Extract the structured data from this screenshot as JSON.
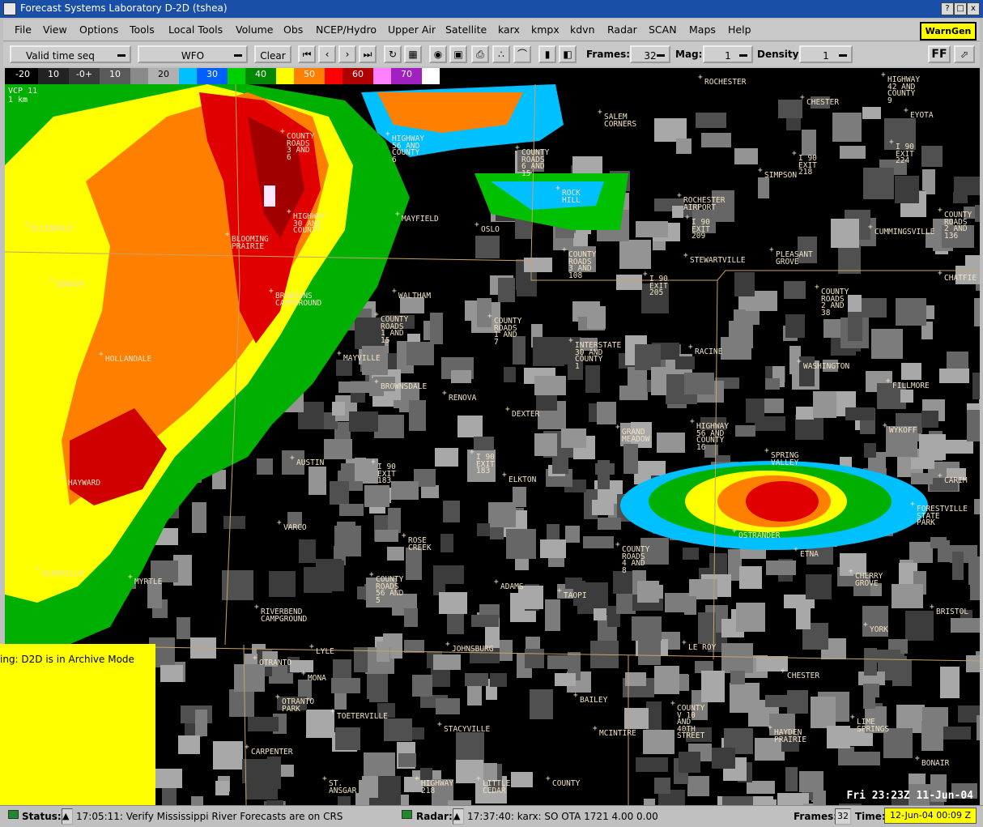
{
  "window": {
    "title": "Forecast Systems Laboratory D-2D (tshea)",
    "buttons": [
      "?",
      "□",
      "x"
    ]
  },
  "menu": [
    "File",
    "View",
    "Options",
    "Tools",
    "Local Tools",
    "Volume",
    "Obs",
    "NCEP/Hydro",
    "Upper Air",
    "Satellite",
    "karx",
    "kmpx",
    "kdvn",
    "Radar",
    "SCAN",
    "Maps",
    "Help"
  ],
  "warngen": "WarnGen",
  "toolbar": {
    "time_mode": "Valid time seq",
    "scale": "WFO",
    "clear": "Clear",
    "frames_label": "Frames:",
    "frames_value": "32",
    "mag_label": "Mag:",
    "mag_value": "1",
    "density_label": "Density:",
    "density_value": "1",
    "ff_label": "FF"
  },
  "colorbar": [
    {
      "label": "-20",
      "color": "#000000"
    },
    {
      "label": "10",
      "color": "#222222"
    },
    {
      "label": "-0+",
      "color": "#3a3a3a"
    },
    {
      "label": "10",
      "color": "#5a5a5a"
    },
    {
      "label": "",
      "color": "#8a8a8a"
    },
    {
      "label": "20",
      "color": "#b0b0b0"
    },
    {
      "label": "",
      "color": "#00c0ff"
    },
    {
      "label": "30",
      "color": "#0060ff"
    },
    {
      "label": "",
      "color": "#00d000"
    },
    {
      "label": "40",
      "color": "#008800"
    },
    {
      "label": "",
      "color": "#ffff00"
    },
    {
      "label": "50",
      "color": "#ff8000"
    },
    {
      "label": "",
      "color": "#ff0000"
    },
    {
      "label": "60",
      "color": "#b00000"
    },
    {
      "label": "",
      "color": "#ff80ff"
    },
    {
      "label": "70",
      "color": "#a020c0"
    },
    {
      "label": "",
      "color": "#ffffff"
    }
  ],
  "product": {
    "line1": "VCP 11",
    "line2": "1 km"
  },
  "places": [
    {
      "name": "ROCHESTER"
    },
    {
      "name": "CHESTER"
    },
    {
      "name": "HIGHWAY\n42 AND\nCOUNTY\n9"
    },
    {
      "name": "EYOTA"
    },
    {
      "name": "SALEM\nCORNERS"
    },
    {
      "name": "COUNTY\nROADS\n3 AND\n6"
    },
    {
      "name": "HIGHWAY\n56 AND\nCOUNTY\n6"
    },
    {
      "name": "COUNTY\nROADS\n6 AND\n15"
    },
    {
      "name": "I 90\nEXIT\n218"
    },
    {
      "name": "I 90\nEXIT\n224"
    },
    {
      "name": "SIMPSON"
    },
    {
      "name": "HIGHWAY\n30 AND\nCOUNTY"
    },
    {
      "name": "ROCK\nHILL"
    },
    {
      "name": "ROCHESTER\nAIRPORT"
    },
    {
      "name": "MAYFIELD"
    },
    {
      "name": "ELLENDALE"
    },
    {
      "name": "BLOOMING\nPRAIRIE"
    },
    {
      "name": "OSLO"
    },
    {
      "name": "I 90\nEXIT\n209"
    },
    {
      "name": "COUNTY\nROADS\n2 AND\n136"
    },
    {
      "name": "CUMMINGSVILLE"
    },
    {
      "name": "STEWARTVILLE"
    },
    {
      "name": "PLEASANT\nGROVE"
    },
    {
      "name": "COUNTY\nROADS\n3 AND\n108"
    },
    {
      "name": "GENEVA"
    },
    {
      "name": "BRONSONS\nCAMPGROUND"
    },
    {
      "name": "WALTHAM"
    },
    {
      "name": "I 90\nEXIT\n205"
    },
    {
      "name": "COUNTY\nROADS\n2 AND\n38"
    },
    {
      "name": "CHATFIE"
    },
    {
      "name": "COUNTY\nROADS\n1 AND\n15"
    },
    {
      "name": "COUNTY\nROADS\n1 AND\n7"
    },
    {
      "name": "RACINE"
    },
    {
      "name": "INTERSTATE\n30 AND\nCOUNTY\n1"
    },
    {
      "name": "HOLLANDALE"
    },
    {
      "name": "MAYVILLE"
    },
    {
      "name": "WASHINGTON"
    },
    {
      "name": "BROWNSDALE"
    },
    {
      "name": "RENOVA"
    },
    {
      "name": "FILLMORE"
    },
    {
      "name": "DEXTER"
    },
    {
      "name": "GRAND\nMEADOW"
    },
    {
      "name": "HIGHWAY\n56 AND\nCOUNTY\n16"
    },
    {
      "name": "WYKOFF"
    },
    {
      "name": "AUSTIN"
    },
    {
      "name": "I 90\nEXIT\n183"
    },
    {
      "name": "I 90\nEXIT\n183"
    },
    {
      "name": "ELKTON"
    },
    {
      "name": "SPRING\nVALLEY"
    },
    {
      "name": "HAYWARD"
    },
    {
      "name": "CARIM"
    },
    {
      "name": "FORESTVILLE\nSTATE\nPARK"
    },
    {
      "name": "VARCO"
    },
    {
      "name": "OSTRANDER"
    },
    {
      "name": "ROSE\nCREEK"
    },
    {
      "name": "COUNTY\nROADS\n4 AND\n8"
    },
    {
      "name": "ETNA"
    },
    {
      "name": "GLENVILLE"
    },
    {
      "name": "MYRTLE"
    },
    {
      "name": "CHERRY\nGROVE"
    },
    {
      "name": "ADAMS"
    },
    {
      "name": "TAOPI"
    },
    {
      "name": "COUNTY\nROADS\n56 AND\n5"
    },
    {
      "name": "RIVERBEND\nCAMPGROUND"
    },
    {
      "name": "YORK"
    },
    {
      "name": "BRISTOL"
    },
    {
      "name": "LYLE"
    },
    {
      "name": "JOHNSBURG"
    },
    {
      "name": "LE ROY"
    },
    {
      "name": "OTRANTO"
    },
    {
      "name": "CHESTER"
    },
    {
      "name": "MONA"
    },
    {
      "name": "BAILEY"
    },
    {
      "name": "OTRANTO\nPARK"
    },
    {
      "name": "TOETERVILLE"
    },
    {
      "name": "COUNTY\nV 10\nAND\n40TH\nSTREET"
    },
    {
      "name": "LIME\nSPRINGS"
    },
    {
      "name": "STACYVILLE"
    },
    {
      "name": "MCINTIRE"
    },
    {
      "name": "HAYDEN\nPRAIRIE"
    },
    {
      "name": "CARPENTER"
    },
    {
      "name": "BONAIR"
    },
    {
      "name": "ST.\nANSGAR"
    },
    {
      "name": "HIGHWAY\n218"
    },
    {
      "name": "LITTLE\nCEDAR"
    },
    {
      "name": "COUNTY"
    }
  ],
  "datetime": "Fri 23:23Z 11-Jun-04",
  "archive_msg": "ing: D2D is in Archive Mode",
  "status": {
    "label": "Status:",
    "message": "17:05:11: Verify Mississippi River Forecasts are on CRS",
    "radar_label": "Radar:",
    "radar_message": "17:37:40: karx: SO  OTA 1721   4.00   0.00",
    "frames_label": "Frames:",
    "frames_value": "32",
    "time_label": "Time:",
    "time_value": "12-Jun-04 00:09 Z"
  }
}
